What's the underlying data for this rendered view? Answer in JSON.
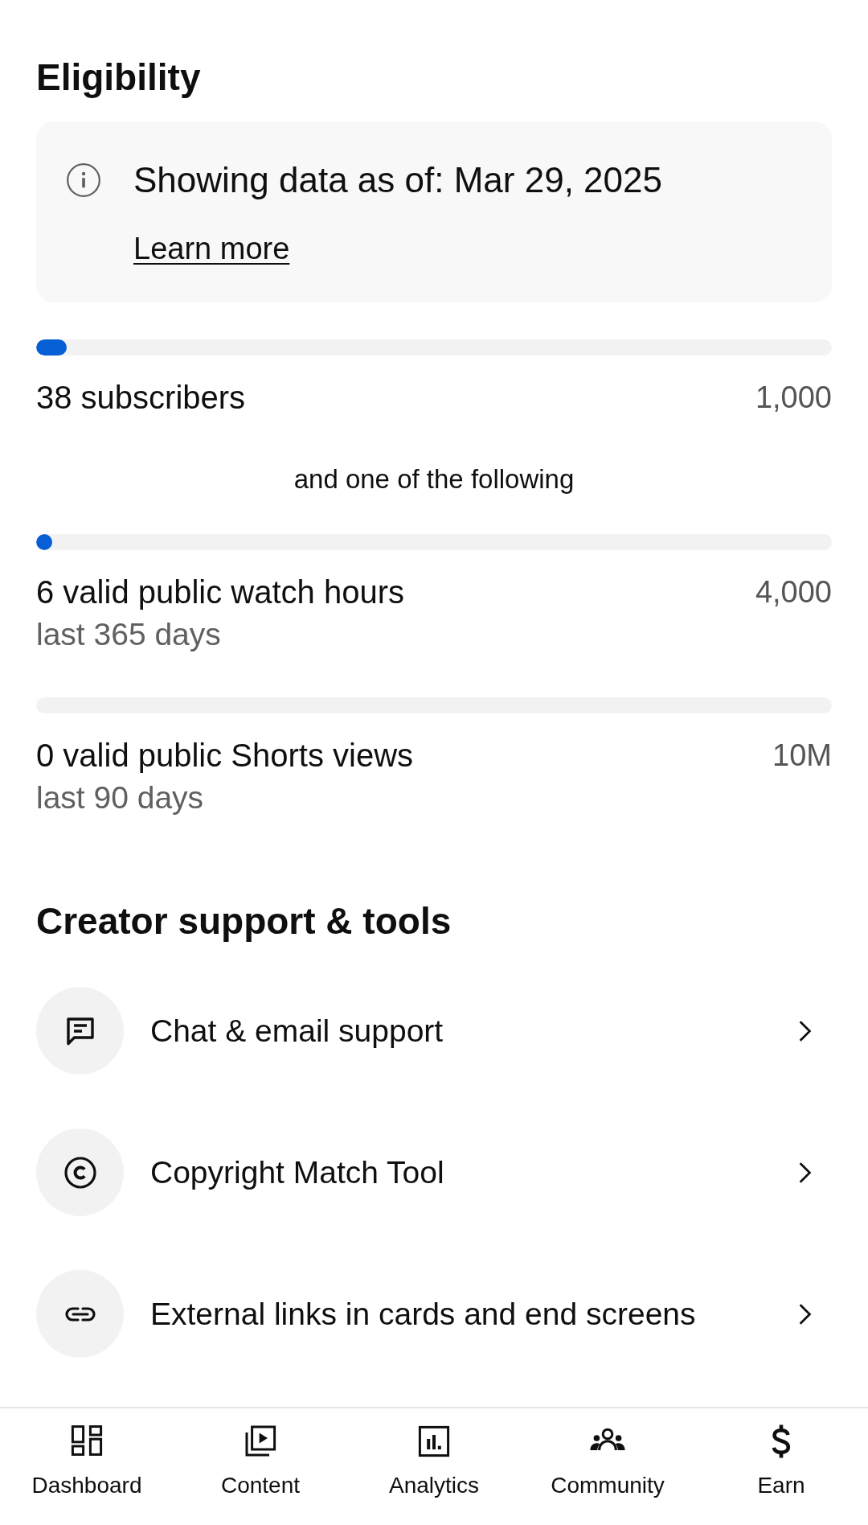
{
  "eligibility": {
    "title": "Eligibility",
    "notice": {
      "text": "Showing data as of: Mar 29, 2025",
      "link": "Learn more"
    },
    "required": [
      {
        "label": "38 subscribers",
        "target": "1,000",
        "level": 0.038
      }
    ],
    "connector": "and one of the following",
    "alternatives": [
      {
        "label": "6 valid public watch hours",
        "period": "last 365 days",
        "target": "4,000",
        "level": 0.0015
      },
      {
        "label": "0 valid public Shorts views",
        "period": "last 90 days",
        "target": "10M"
      }
    ]
  },
  "creator_tools": {
    "title": "Creator support & tools",
    "items": [
      {
        "kind": "chat",
        "label": "Chat & email support"
      },
      {
        "kind": "copyright",
        "label": "Copyright Match Tool"
      },
      {
        "kind": "link",
        "label": "External links in cards and end screens"
      }
    ]
  },
  "bottom_nav": [
    {
      "kind": "dashboard",
      "label": "Dashboard"
    },
    {
      "kind": "content",
      "label": "Content"
    },
    {
      "kind": "analytics",
      "label": "Analytics"
    },
    {
      "kind": "community",
      "label": "Community"
    },
    {
      "kind": "earn",
      "label": "Earn"
    }
  ]
}
